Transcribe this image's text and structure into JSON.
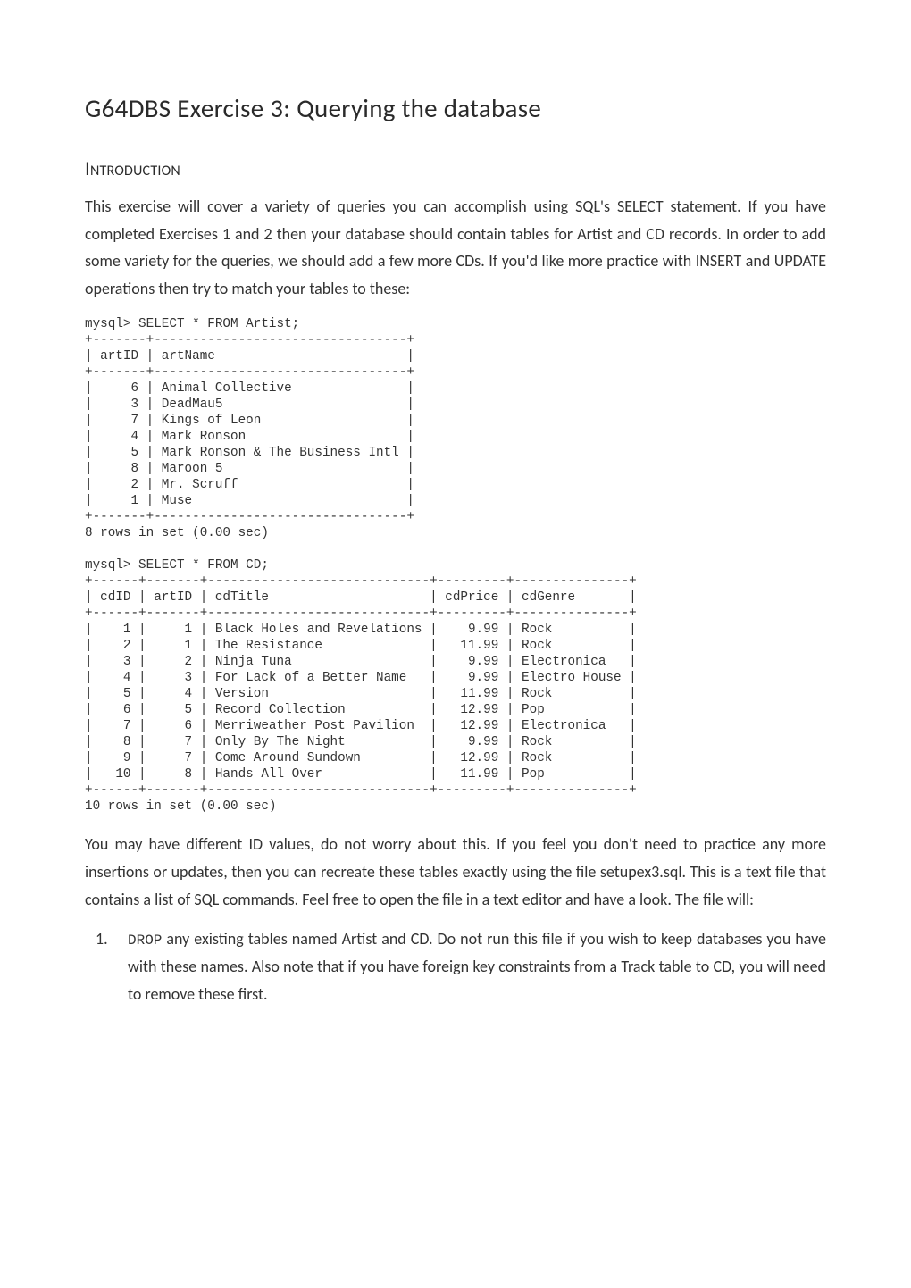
{
  "title": "G64DBS Exercise 3: Querying the database",
  "section_intro": "Introduction",
  "intro_paragraph": "This exercise will cover a variety of queries you can accomplish using SQL's SELECT statement. If you have completed Exercises 1 and 2 then your database should contain tables for Artist and CD records. In order to add some variety for the queries, we should add a few more CDs.  If you'd like more practice with INSERT and UPDATE operations then try to match your tables to these:",
  "terminal_output": "mysql> SELECT * FROM Artist;\n+-------+---------------------------------+\n| artID | artName                         |\n+-------+---------------------------------+\n|     6 | Animal Collective               |\n|     3 | DeadMau5                        |\n|     7 | Kings of Leon                   |\n|     4 | Mark Ronson                     |\n|     5 | Mark Ronson & The Business Intl |\n|     8 | Maroon 5                        |\n|     2 | Mr. Scruff                      |\n|     1 | Muse                            |\n+-------+---------------------------------+\n8 rows in set (0.00 sec)\n\nmysql> SELECT * FROM CD;\n+------+-------+-----------------------------+---------+---------------+\n| cdID | artID | cdTitle                     | cdPrice | cdGenre       |\n+------+-------+-----------------------------+---------+---------------+\n|    1 |     1 | Black Holes and Revelations |    9.99 | Rock          |\n|    2 |     1 | The Resistance              |   11.99 | Rock          |\n|    3 |     2 | Ninja Tuna                  |    9.99 | Electronica   |\n|    4 |     3 | For Lack of a Better Name   |    9.99 | Electro House |\n|    5 |     4 | Version                     |   11.99 | Rock          |\n|    6 |     5 | Record Collection           |   12.99 | Pop           |\n|    7 |     6 | Merriweather Post Pavilion  |   12.99 | Electronica   |\n|    8 |     7 | Only By The Night           |    9.99 | Rock          |\n|    9 |     7 | Come Around Sundown         |   12.99 | Rock          |\n|   10 |     8 | Hands All Over              |   11.99 | Pop           |\n+------+-------+-----------------------------+---------+---------------+\n10 rows in set (0.00 sec)",
  "after_terminal_paragraph": "You may have different ID values, do not worry about this. If you feel you don't need to practice any more insertions or updates, then you can recreate these tables exactly using the file setupex3.sql. This is a text file that contains a list of SQL commands. Feel free to open the file in a text editor and have a look. The file will:",
  "list_item_1_number": "1.",
  "list_item_1_code": "DROP",
  "list_item_1_text": " any existing tables named Artist and CD. Do not run this file if you wish to keep databases you have with these names. Also note that if you have foreign key constraints from a Track table to CD, you will need to remove these first."
}
